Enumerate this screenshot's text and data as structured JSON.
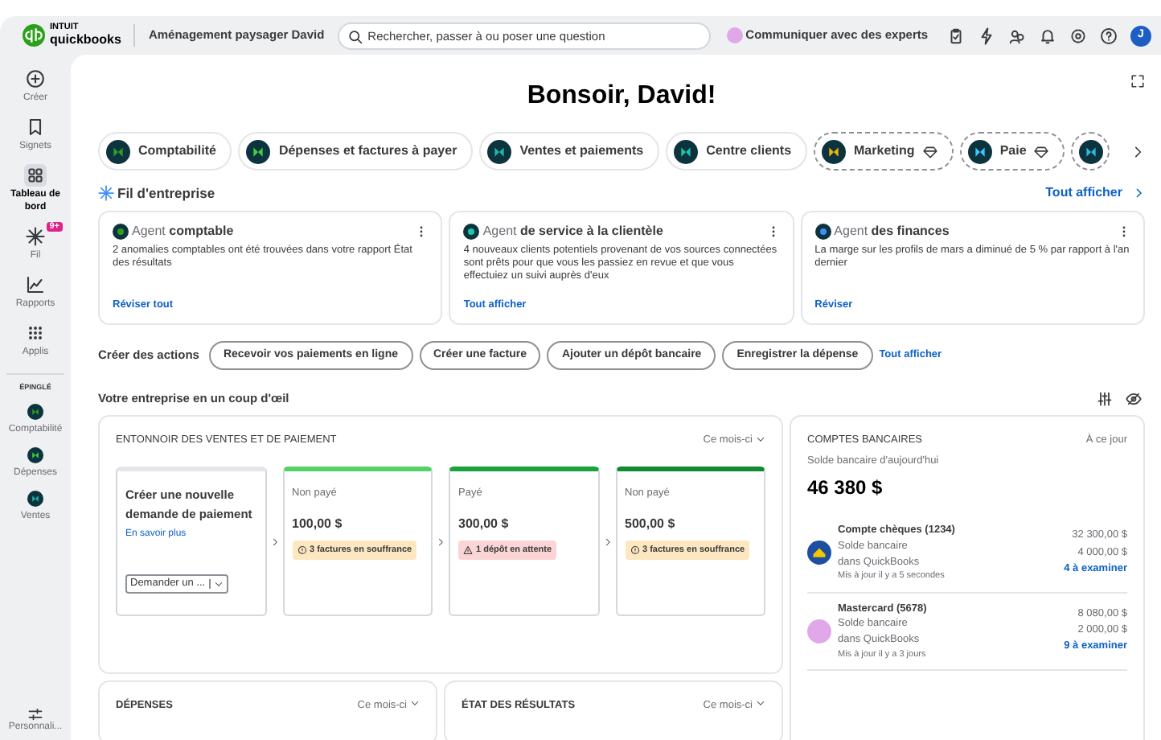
{
  "topbar": {
    "logo_top": "INTUIT",
    "logo_bottom": "quickbooks",
    "company": "Aménagement paysager David",
    "search_placeholder": "Rechercher, passer à ou poser une question",
    "experts": "Communiquer avec des experts",
    "avatar": "J"
  },
  "sidebar": {
    "items": [
      {
        "label": "Créer",
        "selected": false
      },
      {
        "label": "Signets",
        "selected": false
      },
      {
        "label": "Tableau de bord",
        "selected": true
      },
      {
        "label": "Fil",
        "selected": false,
        "badge": "9+"
      },
      {
        "label": "Rapports",
        "selected": false
      },
      {
        "label": "Applis",
        "selected": false
      }
    ],
    "pinned_heading": "ÉPINGLÉ",
    "pinned": [
      {
        "label": "Comptabilité",
        "color": "#2ca01c"
      },
      {
        "label": "Dépenses",
        "color": "#3fd33f"
      },
      {
        "label": "Ventes",
        "color": "#1fb8a6"
      }
    ],
    "customize": "Personnali..."
  },
  "greeting": "Bonsoir, David!",
  "apps": [
    {
      "kind": "chip",
      "label": "Comptabilité",
      "color": "#2ca01c",
      "premium": false
    },
    {
      "kind": "chip",
      "label": "Dépenses et factures à payer",
      "color": "#3fd33f",
      "premium": false
    },
    {
      "kind": "chip",
      "label": "Ventes et paiements",
      "color": "#1fb8a6",
      "premium": false
    },
    {
      "kind": "chip",
      "label": "Centre clients",
      "color": "#19c9a8",
      "premium": false
    },
    {
      "kind": "chip",
      "label": "Marketing",
      "color": "#f2b705",
      "premium": true
    },
    {
      "kind": "chip",
      "label": "Paie",
      "color": "#3ec6ff",
      "premium": true
    },
    {
      "kind": "icon_only",
      "color": "#2fb8e0",
      "premium": true
    }
  ],
  "feed": {
    "title": "Fil d'entreprise",
    "show_all": "Tout afficher",
    "cards": [
      {
        "agent": "Agent",
        "name": "comptable",
        "color": "#2ca01c",
        "body": "2 anomalies comptables ont été trouvées dans votre rapport État des résultats",
        "link": "Réviser tout"
      },
      {
        "agent": "Agent",
        "name": "de service à la clientèle",
        "color": "#19c9a8",
        "body": "4 nouveaux clients potentiels provenant de vos sources connectées sont prêts pour que vous les passiez en revue et que vous effectuiez un suivi auprès d'eux",
        "link": "Tout afficher"
      },
      {
        "agent": "Agent",
        "name": "des finances",
        "color": "#3e8ef7",
        "body": "La marge sur les profils de mars a diminué de 5 % par rapport à l'an dernier",
        "link": "Réviser"
      }
    ]
  },
  "actions": {
    "label": "Créer des actions",
    "buttons": [
      "Recevoir vos paiements en ligne",
      "Créer une facture",
      "Ajouter un dépôt bancaire",
      "Enregistrer la dépense"
    ],
    "show_all": "Tout afficher"
  },
  "glance": {
    "title": "Votre entreprise en un coup d'œil",
    "funnel": {
      "title": "ENTONNOIR DES VENTES ET DE PAIEMENT",
      "period": "Ce mois-ci",
      "intro": {
        "title": "Créer une nouvelle demande de paiement",
        "link": "En savoir plus",
        "select_value": "Demander un ..."
      },
      "stages": [
        {
          "label": "Non payé",
          "amount": "100,00 $",
          "alert": "3 factures en souffrance",
          "kind": "warning",
          "color": "#53d364"
        },
        {
          "label": "Payé",
          "amount": "300,00 $",
          "alert": "1 dépôt en attente",
          "kind": "danger",
          "color": "#1aa33c"
        },
        {
          "label": "Non payé",
          "amount": "500,00 $",
          "alert": "3 factures en souffrance",
          "kind": "warning",
          "color": "#108a33"
        }
      ]
    },
    "bottom_cards": [
      {
        "title": "DÉPENSES",
        "period": "Ce mois-ci"
      },
      {
        "title": "ÉTAT DES RÉSULTATS",
        "period": "Ce mois-ci"
      }
    ],
    "bank": {
      "title": "COMPTES BANCAIRES",
      "as_of": "À ce jour",
      "balance_label": "Solde bancaire d'aujourd'hui",
      "balance": "46 380 $",
      "accounts": [
        {
          "name": "Compte chèques (1234)",
          "line1": "Solde bancaire",
          "line2": "dans QuickBooks",
          "updated": "Mis à jour il y a 5 secondes",
          "bank_amount": "32 300,00 $",
          "qb_amount": "4 000,00 $",
          "review": "4 à examiner",
          "kind": "bank",
          "color": "#1c4fa0"
        },
        {
          "name": "Mastercard (5678)",
          "line1": "Solde bancaire",
          "line2": "dans QuickBooks",
          "updated": "Mis à jour il y a 3 jours",
          "bank_amount": "8 080,00 $",
          "qb_amount": "2 000,00 $",
          "review": "9 à examiner",
          "kind": "plain",
          "color": "#e0a8e8"
        }
      ]
    }
  }
}
